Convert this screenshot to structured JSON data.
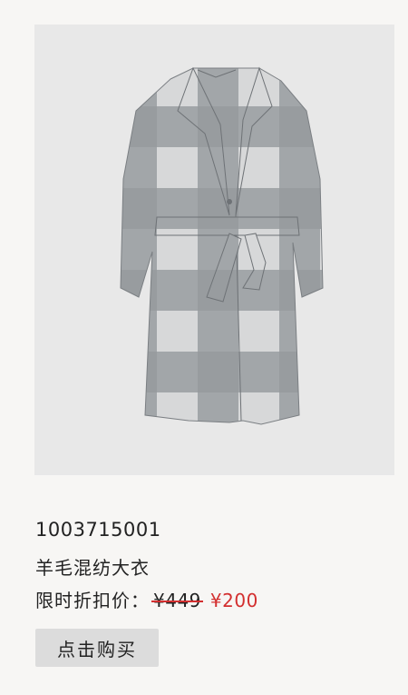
{
  "product": {
    "image_alt": "grey plaid wool-blend coat",
    "sku": "1003715001",
    "name": "羊毛混纺大衣",
    "price_label": "限时折扣价：",
    "original_price": "¥449",
    "sale_price": "¥200",
    "buy_label": "点击购买"
  },
  "colors": {
    "background": "#f7f6f4",
    "image_background": "#e8e8e8",
    "sale_red": "#d32f2f",
    "button_bg": "#dcdcdc"
  }
}
